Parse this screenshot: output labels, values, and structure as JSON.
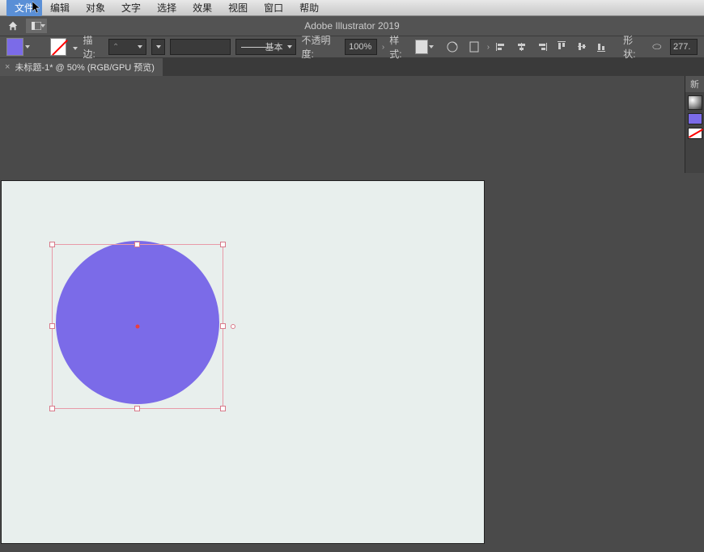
{
  "menu": {
    "items": [
      "文件",
      "编辑",
      "对象",
      "文字",
      "选择",
      "效果",
      "视图",
      "窗口",
      "帮助"
    ]
  },
  "app": {
    "title": "Adobe Illustrator 2019"
  },
  "controlbar": {
    "stroke_label": "描边:",
    "stroke_weight": "",
    "preset_label": "基本",
    "opacity_label": "不透明度:",
    "opacity_value": "100%",
    "style_label": "样式:",
    "shape_label": "形状:",
    "shape_icon": "⬭",
    "shape_value": "277."
  },
  "tab": {
    "label": "未标题-1* @ 50% (RGB/GPU 预览)"
  },
  "panel": {
    "title": "新"
  },
  "colors": {
    "fill": "#7b6be8",
    "artboard_bg": "#e8efed",
    "selection": "#e89aa8"
  }
}
